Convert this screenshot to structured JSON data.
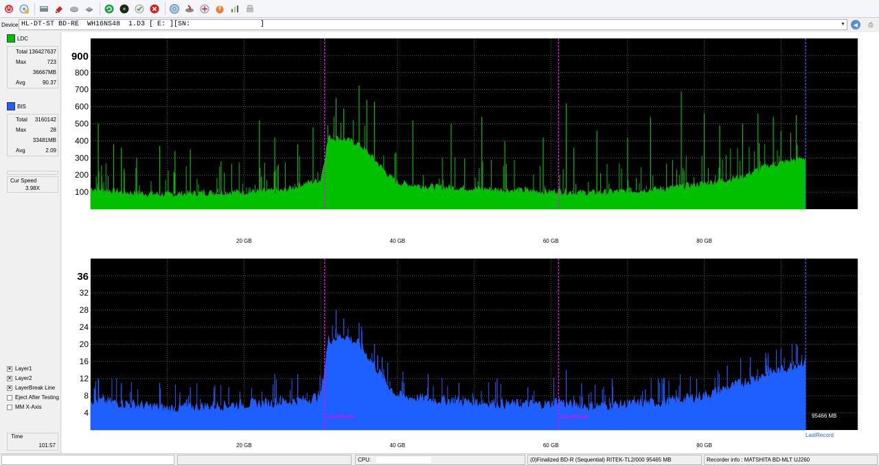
{
  "toolbar": {
    "buttons": [
      "power-icon",
      "eject-disc-icon",
      "drive-icon",
      "erase-icon",
      "disc-icon",
      "save-icon",
      "refresh-icon",
      "disc-quality-icon",
      "scan-icon",
      "stop-icon",
      "cd-icon",
      "burn-icon",
      "copy-icon",
      "fire-icon",
      "chart-icon",
      "settings-icon"
    ]
  },
  "device": {
    "label": "Device:",
    "value": "HL-DT-ST BD-RE  WH16NS48  1.D3 [ E: ][SN:                 ]"
  },
  "ldc": {
    "name": "LDC",
    "color": "#00c000",
    "total_label": "Total",
    "total": "136427637",
    "max_label": "Max",
    "max": "723",
    "max_pos": "36667MB",
    "avg_label": "Avg",
    "avg": "90.37"
  },
  "bis": {
    "name": "BIS",
    "color": "#1e5fff",
    "total_label": "Total",
    "total": "3160142",
    "max_label": "Max",
    "max": "28",
    "max_pos": "33481MB",
    "avg_label": "Avg",
    "avg": "2.09"
  },
  "cur_speed": {
    "label": "Cur Speed",
    "value": "3.98X"
  },
  "options": [
    {
      "label": "Layer1",
      "checked": true
    },
    {
      "label": "Layer2",
      "checked": true
    },
    {
      "label": "LayerBreak Line",
      "checked": true
    },
    {
      "label": "Eject After Testing",
      "checked": false
    },
    {
      "label": "MM X-Axis",
      "checked": false
    }
  ],
  "time": {
    "label": "Time",
    "value": "101:57"
  },
  "chart_data": [
    {
      "type": "area",
      "name": "LDC",
      "ylim": [
        0,
        1000
      ],
      "yticks": [
        "100",
        "200",
        "300",
        "400",
        "500",
        "600",
        "700",
        "800",
        "900"
      ],
      "xticks": [
        "20 GB",
        "40 GB",
        "60 GB",
        "80 GB"
      ],
      "xlim_gb": [
        0,
        100
      ],
      "layer_breaks_gb": [
        30.5,
        61.0
      ],
      "last_record_gb": 93.2,
      "x": [
        0,
        5,
        10,
        15,
        20,
        25,
        28,
        30,
        31,
        33,
        35,
        37,
        39,
        40,
        42,
        45,
        50,
        55,
        60,
        61,
        62,
        65,
        70,
        75,
        80,
        85,
        88,
        90,
        93
      ],
      "values": [
        120,
        95,
        85,
        95,
        100,
        105,
        150,
        170,
        420,
        410,
        380,
        290,
        190,
        155,
        140,
        130,
        120,
        110,
        100,
        110,
        100,
        95,
        105,
        120,
        150,
        190,
        250,
        270,
        300
      ],
      "spikes_x": [
        1,
        3,
        4,
        6,
        9,
        11,
        13,
        17,
        22,
        24,
        27,
        29,
        32,
        33,
        35,
        36,
        37,
        42,
        47,
        51,
        54,
        59,
        62,
        63,
        66,
        70,
        73,
        77,
        80,
        82,
        85,
        87,
        89,
        90,
        92
      ],
      "spikes_y": [
        500,
        380,
        360,
        300,
        370,
        340,
        350,
        280,
        520,
        420,
        380,
        480,
        650,
        590,
        723,
        640,
        630,
        520,
        500,
        540,
        400,
        420,
        620,
        360,
        460,
        420,
        540,
        690,
        560,
        490,
        500,
        560,
        540,
        460,
        550
      ]
    },
    {
      "type": "area",
      "name": "BIS",
      "ylim": [
        0,
        40
      ],
      "yticks": [
        "4",
        "8",
        "12",
        "16",
        "20",
        "24",
        "28",
        "32",
        "36"
      ],
      "xticks": [
        "20 GB",
        "40 GB",
        "60 GB",
        "80 GB"
      ],
      "xlim_gb": [
        0,
        100
      ],
      "layer_breaks_gb": [
        30.5,
        61.0
      ],
      "last_record_gb": 93.2,
      "x": [
        0,
        5,
        10,
        15,
        20,
        25,
        28,
        30,
        31,
        33,
        35,
        37,
        39,
        40,
        42,
        45,
        50,
        55,
        60,
        61,
        62,
        65,
        70,
        75,
        80,
        85,
        88,
        90,
        93
      ],
      "values": [
        7,
        6,
        5,
        5.5,
        6,
        6.5,
        7,
        8,
        21,
        22,
        20,
        15,
        10,
        8,
        7.5,
        7,
        6.5,
        6,
        6,
        7,
        6,
        5.5,
        6,
        6.5,
        8,
        11,
        13,
        14,
        16
      ],
      "spikes_x": [
        1,
        4,
        9,
        13,
        18,
        24,
        27,
        32,
        33,
        35,
        37,
        38,
        44,
        48,
        53,
        57,
        62,
        64,
        68,
        74,
        79,
        83,
        86,
        88,
        90,
        92
      ],
      "spikes_y": [
        12,
        11,
        11,
        10,
        10,
        13,
        13,
        28,
        26,
        25,
        20,
        17,
        13,
        11,
        12,
        10,
        14,
        11,
        12,
        12,
        12,
        15,
        17,
        18,
        19,
        20
      ],
      "layer_break_label": "LayerBreak",
      "capacity_label": "95466 MB",
      "last_record_label": "LastRecord"
    }
  ],
  "status": {
    "cpu_label": "CPU:",
    "disc_info": "(0)Finalized  BD-R (Sequential)  RITEK-TL2/000  95465 MB",
    "recorder_info": "Recorder info : MATSHITA     BD-MLT UJ260"
  }
}
